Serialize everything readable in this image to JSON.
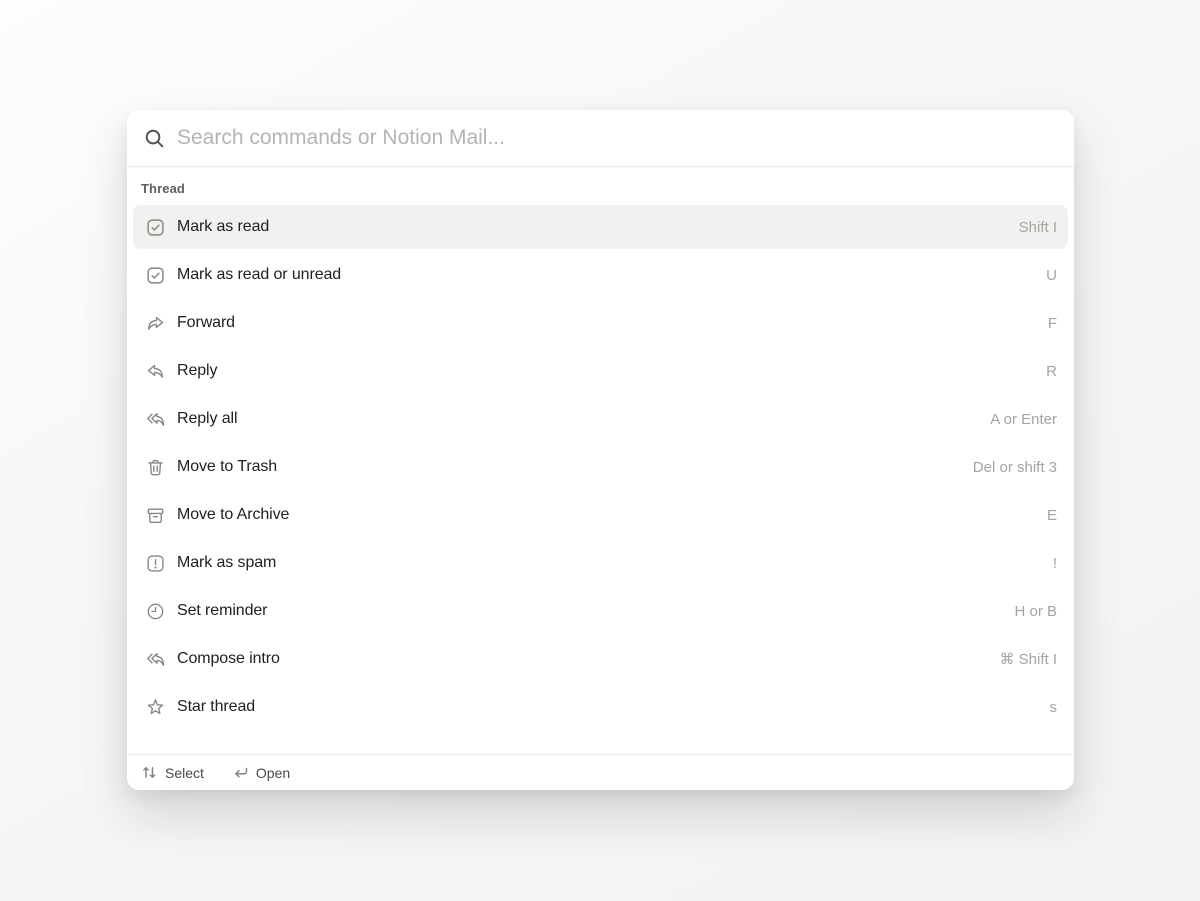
{
  "search": {
    "placeholder": "Search commands or Notion Mail...",
    "icon": "search-icon"
  },
  "section": {
    "label": "Thread"
  },
  "items": [
    {
      "label": "Mark as read",
      "shortcut": "Shift I",
      "icon": "checkbox-checked-icon",
      "selected": true
    },
    {
      "label": "Mark as read or unread",
      "shortcut": "U",
      "icon": "checkbox-checked-icon",
      "selected": false
    },
    {
      "label": "Forward",
      "shortcut": "F",
      "icon": "forward-arrow-icon",
      "selected": false
    },
    {
      "label": "Reply",
      "shortcut": "R",
      "icon": "reply-arrow-icon",
      "selected": false
    },
    {
      "label": "Reply all",
      "shortcut": "A or Enter",
      "icon": "reply-all-arrow-icon",
      "selected": false
    },
    {
      "label": "Move to Trash",
      "shortcut": "Del or shift 3",
      "icon": "trash-icon",
      "selected": false
    },
    {
      "label": "Move to Archive",
      "shortcut": "E",
      "icon": "archive-box-icon",
      "selected": false
    },
    {
      "label": "Mark as spam",
      "shortcut": "!",
      "icon": "spam-warning-icon",
      "selected": false
    },
    {
      "label": "Set reminder",
      "shortcut": "H or B",
      "icon": "clock-icon",
      "selected": false
    },
    {
      "label": "Compose intro",
      "shortcut": "⌘ Shift I",
      "icon": "reply-all-arrow-icon",
      "selected": false
    },
    {
      "label": "Star thread",
      "shortcut": "s",
      "icon": "star-icon",
      "selected": false
    }
  ],
  "footer": {
    "hints": [
      {
        "icon": "up-down-arrows-icon",
        "label": "Select"
      },
      {
        "icon": "return-key-icon",
        "label": "Open"
      }
    ]
  },
  "colors": {
    "palette_bg": "#ffffff",
    "page_bg": "#f6f6f4",
    "highlight": "#f1f1ef",
    "divider": "#edecea",
    "text_primary": "#22211f",
    "text_section": "#5f5e5a",
    "text_shortcut": "#a5a4a0",
    "text_footer": "#4b4a46",
    "icon_gray": "#878682",
    "placeholder_gray": "#b5b4b1"
  }
}
